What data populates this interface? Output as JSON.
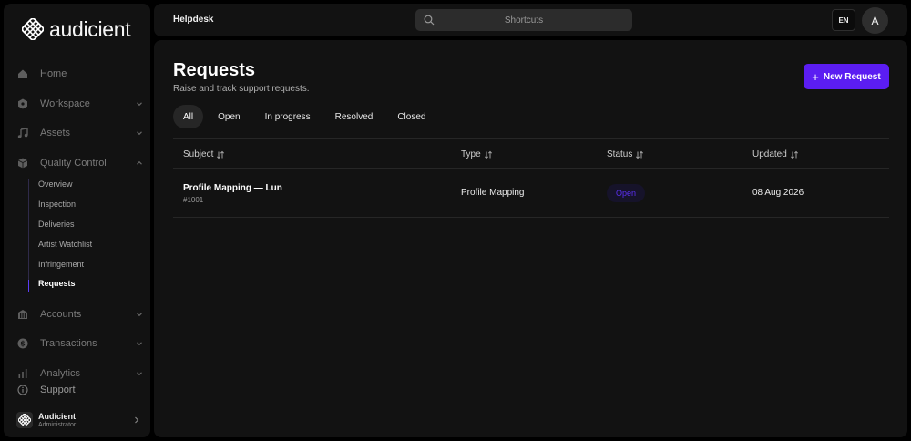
{
  "brand": {
    "name": "audicient"
  },
  "header": {
    "title": "Helpdesk",
    "search_placeholder": "Shortcuts",
    "lang": "EN",
    "avatar_initial": "A"
  },
  "sidebar": {
    "items": [
      {
        "label": "Home",
        "icon": "home-icon"
      },
      {
        "label": "Workspace",
        "icon": "hexagon-icon",
        "expandable": true
      },
      {
        "label": "Assets",
        "icon": "music-note-icon",
        "expandable": true
      },
      {
        "label": "Quality Control",
        "icon": "box-icon",
        "expandable": true,
        "expanded": true
      },
      {
        "label": "Accounts",
        "icon": "building-icon",
        "expandable": true
      },
      {
        "label": "Transactions",
        "icon": "dollar-icon",
        "expandable": true
      },
      {
        "label": "Analytics",
        "icon": "bar-chart-icon",
        "expandable": true
      },
      {
        "label": "Support",
        "icon": "info-icon"
      }
    ],
    "subitems": [
      "Overview",
      "Inspection",
      "Deliveries",
      "Artist Watchlist",
      "Infringement",
      "Requests"
    ],
    "active_subitem": "Requests",
    "user": {
      "name": "Audicient",
      "role": "Administrator"
    }
  },
  "main": {
    "title": "Requests",
    "subtitle": "Raise and track support requests.",
    "new_button": "New Request",
    "tabs": [
      "All",
      "Open",
      "In progress",
      "Resolved",
      "Closed"
    ],
    "active_tab": "All",
    "columns": [
      "Subject",
      "Type",
      "Status",
      "Updated"
    ],
    "rows": [
      {
        "subject": "Profile Mapping — Lun",
        "id": "#1001",
        "type": "Profile Mapping",
        "status": "Open",
        "updated": "08 Aug 2026"
      }
    ]
  },
  "colors": {
    "accent": "#5b1df2",
    "status_open": "#5b2ff2",
    "background": "#121212"
  }
}
